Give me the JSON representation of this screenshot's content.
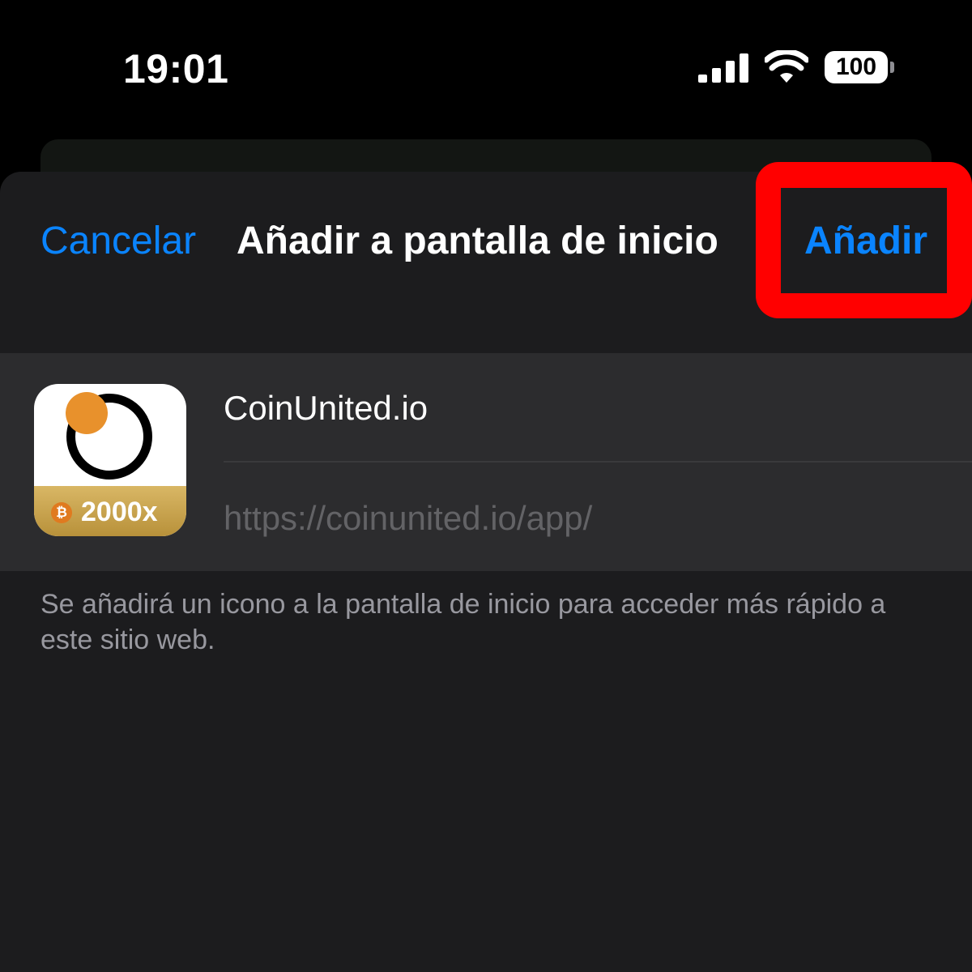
{
  "status_bar": {
    "time": "19:01",
    "battery_level": "100",
    "icons": [
      "cellular-signal-icon",
      "wifi-icon",
      "battery-icon"
    ]
  },
  "nav": {
    "cancel_label": "Cancelar",
    "title": "Añadir a pantalla de inicio",
    "add_label": "Añadir"
  },
  "web_clip": {
    "name": "CoinUnited.io",
    "url": "https://coinunited.io/app/",
    "icon_badge": "2000x",
    "icon_coin_symbol": "₿"
  },
  "footnote": "Se añadirá un icono a la pantalla de inicio para acceder más rápido a este sitio web.",
  "colors": {
    "accent": "#0a84ff",
    "highlight": "#ff0000",
    "sheet_background": "#1c1c1e",
    "group_background": "#2c2c2e",
    "icon_orange": "#e8912c",
    "icon_gold": "#c9a34e"
  }
}
